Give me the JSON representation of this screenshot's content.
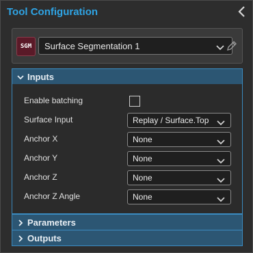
{
  "header": {
    "title": "Tool Configuration",
    "collapse_icon": "chevron-left-icon"
  },
  "tool": {
    "badge": "SGM",
    "name": "Surface Segmentation 1",
    "badge_color": "#5a1a28",
    "edit_icon": "pencil-icon"
  },
  "colors": {
    "accent": "#2fa5e6",
    "section_header": "#2c5673",
    "section_border": "#3b8bc0"
  },
  "sections": {
    "inputs": {
      "label": "Inputs",
      "expanded": true,
      "rows": [
        {
          "label": "Enable batching",
          "type": "checkbox",
          "checked": false
        },
        {
          "label": "Surface Input",
          "type": "dropdown",
          "value": "Replay / Surface.Top"
        },
        {
          "label": "Anchor X",
          "type": "dropdown",
          "value": "None"
        },
        {
          "label": "Anchor Y",
          "type": "dropdown",
          "value": "None"
        },
        {
          "label": "Anchor Z",
          "type": "dropdown",
          "value": "None"
        },
        {
          "label": "Anchor Z Angle",
          "type": "dropdown",
          "value": "None"
        }
      ]
    },
    "parameters": {
      "label": "Parameters",
      "expanded": false
    },
    "outputs": {
      "label": "Outputs",
      "expanded": false
    }
  }
}
